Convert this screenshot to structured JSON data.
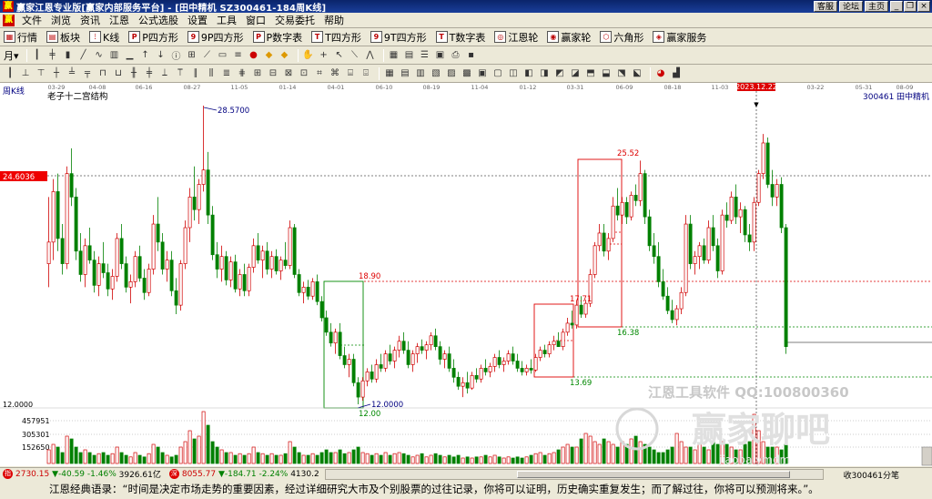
{
  "titlebar": {
    "app_glyph": "赢",
    "title": "赢家江恩专业版[赢家内部服务平台] - [田中精机   SZ300461-184周K线]",
    "links": [
      "客服",
      "论坛",
      "主页"
    ],
    "win_buttons": [
      "0",
      "1",
      "r"
    ]
  },
  "menu": {
    "logo": "赢",
    "items": [
      "文件",
      "浏览",
      "资讯",
      "江恩",
      "公式选股",
      "设置",
      "工具",
      "窗口",
      "交易委托",
      "帮助"
    ]
  },
  "toolbar1": {
    "items": [
      {
        "icon": "grid-icon",
        "glyph": "▦",
        "label": "行情"
      },
      {
        "icon": "blocks-icon",
        "glyph": "▤",
        "label": "板块"
      },
      {
        "icon": "kline-icon",
        "glyph": "⫶",
        "label": "K线"
      },
      {
        "icon": "p-square-icon",
        "glyph": "P",
        "label": "P四方形"
      },
      {
        "icon": "9p-square-icon",
        "glyph": "9",
        "label": "9P四方形"
      },
      {
        "icon": "p-numtable-icon",
        "glyph": "P",
        "label": "P数字表"
      },
      {
        "icon": "t-square-icon",
        "glyph": "T",
        "label": "T四方形"
      },
      {
        "icon": "9t-square-icon",
        "glyph": "9",
        "label": "9T四方形"
      },
      {
        "icon": "t-numtable-icon",
        "glyph": "T",
        "label": "T数字表"
      },
      {
        "icon": "gann-wheel-icon",
        "glyph": "◎",
        "label": "江恩轮"
      },
      {
        "icon": "winner-wheel-icon",
        "glyph": "◉",
        "label": "赢家轮"
      },
      {
        "icon": "hexagon-icon",
        "glyph": "⬡",
        "label": "六角形"
      },
      {
        "icon": "service-icon",
        "glyph": "◈",
        "label": "赢家服务"
      }
    ]
  },
  "toolbar2": {
    "period_label": "月",
    "period_arrow": "▾"
  },
  "chart": {
    "period_label": "周K线",
    "study_label": "老子十二宫结构",
    "stock_code": "300461",
    "stock_name": "田中精机",
    "current_price_label": "24.6036",
    "volume_max_label": "12.0000",
    "volume_ticks": [
      "457951",
      "305301",
      "152650"
    ],
    "date_labels": [
      "03-29",
      "04-08",
      "06-16",
      "08-27",
      "11-05",
      "01-14",
      "04-01",
      "06-10",
      "08-19",
      "11-04",
      "01-12",
      "03-31",
      "06-09",
      "08-18",
      "11-03",
      "2023.12.22",
      "03-22",
      "05-31",
      "08-09"
    ],
    "annotations": {
      "high": "28.5700",
      "low": "12.0000",
      "box1_top": "18.90",
      "box1_bottom": "12.00",
      "box2_top": "17.71",
      "box2_bottom": "13.69",
      "box3_top": "25.52",
      "box3_bottom": "16.38"
    },
    "watermark_line1": "江恩工具软件  QQ:100800360",
    "watermark_line2": "赢家聊吧",
    "watermark_url": "jiaoba.ymdm"
  },
  "statusbar": {
    "idx1_value": "2730.15",
    "idx1_change": "▼-40.59",
    "idx1_pct": "-1.46%",
    "idx1_amt": "3926.61亿",
    "idx2_value": "8055.77",
    "idx2_change": "▼-184.71",
    "idx2_pct": "-2.24%",
    "idx2_amt": "4130.2",
    "right_text": "收300461分笔"
  },
  "quote": "江恩经典语录：“时间是决定市场走势的重要因素，经过详细研究大市及个别股票的过往记录，你将可以证明，历史确实重复发生；而了解过往，你将可以预测将来。”。",
  "colors": {
    "up": "#d00000",
    "down": "#008000",
    "title_bg": "#0a246a",
    "box_red": "#d00000",
    "box_green": "#008000"
  }
}
